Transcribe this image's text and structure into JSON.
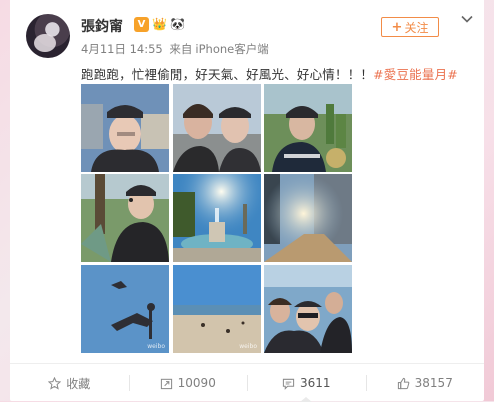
{
  "post": {
    "author": "張鈞甯",
    "badges": {
      "verified": "V",
      "crown": "👑",
      "panda": "🐼"
    },
    "date": "4月11日 14:55",
    "source_prefix": "来自",
    "source": "iPhone客户端",
    "follow_label": "关注",
    "text_main": "跑跑跑，忙裡偷閒，好天氣、好風光、好心情！！！",
    "text_tag": "#愛豆能量月#",
    "photos": [
      {
        "id": 1,
        "subject": "selfie-cap-street"
      },
      {
        "id": 2,
        "subject": "two-selfie-road"
      },
      {
        "id": 3,
        "subject": "selfie-cap-cactus"
      },
      {
        "id": 4,
        "subject": "selfie-cap-tree"
      },
      {
        "id": 5,
        "subject": "fountain-sun"
      },
      {
        "id": 6,
        "subject": "sunlit-sidewalk"
      },
      {
        "id": 7,
        "subject": "sky-bird-lamp"
      },
      {
        "id": 8,
        "subject": "beach-sand"
      },
      {
        "id": 9,
        "subject": "group-selfie"
      }
    ]
  },
  "actions": {
    "favorite_label": "收藏",
    "repost_count": "10090",
    "comment_count": "3611",
    "like_count": "38157"
  },
  "colors": {
    "accent": "#eb7350",
    "follow": "#f28c48",
    "meta": "#808080"
  }
}
